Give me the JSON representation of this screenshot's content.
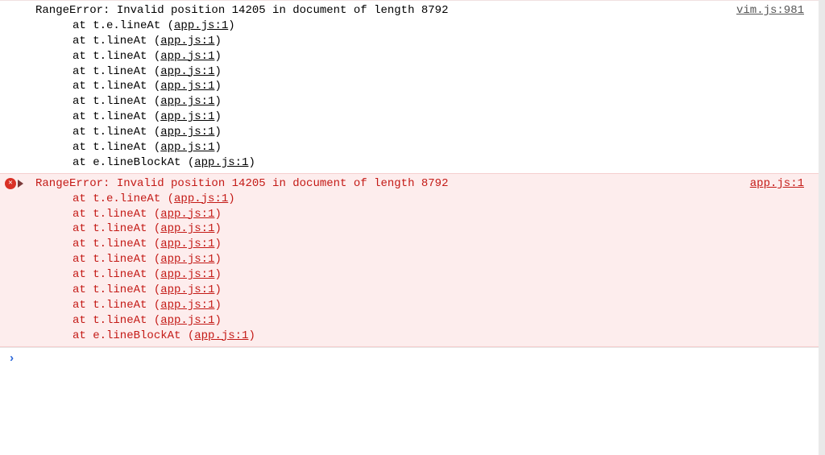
{
  "entries": [
    {
      "kind": "white",
      "source": "vim.js:981",
      "message": "RangeError: Invalid position 14205 in document of length 8792",
      "stack": [
        {
          "prefix": "at t.e.lineAt (",
          "file": "app.js:1",
          "suffix": ")"
        },
        {
          "prefix": "at t.lineAt (",
          "file": "app.js:1",
          "suffix": ")"
        },
        {
          "prefix": "at t.lineAt (",
          "file": "app.js:1",
          "suffix": ")"
        },
        {
          "prefix": "at t.lineAt (",
          "file": "app.js:1",
          "suffix": ")"
        },
        {
          "prefix": "at t.lineAt (",
          "file": "app.js:1",
          "suffix": ")"
        },
        {
          "prefix": "at t.lineAt (",
          "file": "app.js:1",
          "suffix": ")"
        },
        {
          "prefix": "at t.lineAt (",
          "file": "app.js:1",
          "suffix": ")"
        },
        {
          "prefix": "at t.lineAt (",
          "file": "app.js:1",
          "suffix": ")"
        },
        {
          "prefix": "at t.lineAt (",
          "file": "app.js:1",
          "suffix": ")"
        },
        {
          "prefix": "at e.lineBlockAt (",
          "file": "app.js:1",
          "suffix": ")"
        }
      ]
    },
    {
      "kind": "red",
      "source": "app.js:1",
      "message": "RangeError: Invalid position 14205 in document of length 8792",
      "stack": [
        {
          "prefix": "at t.e.lineAt (",
          "file": "app.js:1",
          "suffix": ")"
        },
        {
          "prefix": "at t.lineAt (",
          "file": "app.js:1",
          "suffix": ")"
        },
        {
          "prefix": "at t.lineAt (",
          "file": "app.js:1",
          "suffix": ")"
        },
        {
          "prefix": "at t.lineAt (",
          "file": "app.js:1",
          "suffix": ")"
        },
        {
          "prefix": "at t.lineAt (",
          "file": "app.js:1",
          "suffix": ")"
        },
        {
          "prefix": "at t.lineAt (",
          "file": "app.js:1",
          "suffix": ")"
        },
        {
          "prefix": "at t.lineAt (",
          "file": "app.js:1",
          "suffix": ")"
        },
        {
          "prefix": "at t.lineAt (",
          "file": "app.js:1",
          "suffix": ")"
        },
        {
          "prefix": "at t.lineAt (",
          "file": "app.js:1",
          "suffix": ")"
        },
        {
          "prefix": "at e.lineBlockAt (",
          "file": "app.js:1",
          "suffix": ")"
        }
      ]
    }
  ],
  "prompt_symbol": "›"
}
